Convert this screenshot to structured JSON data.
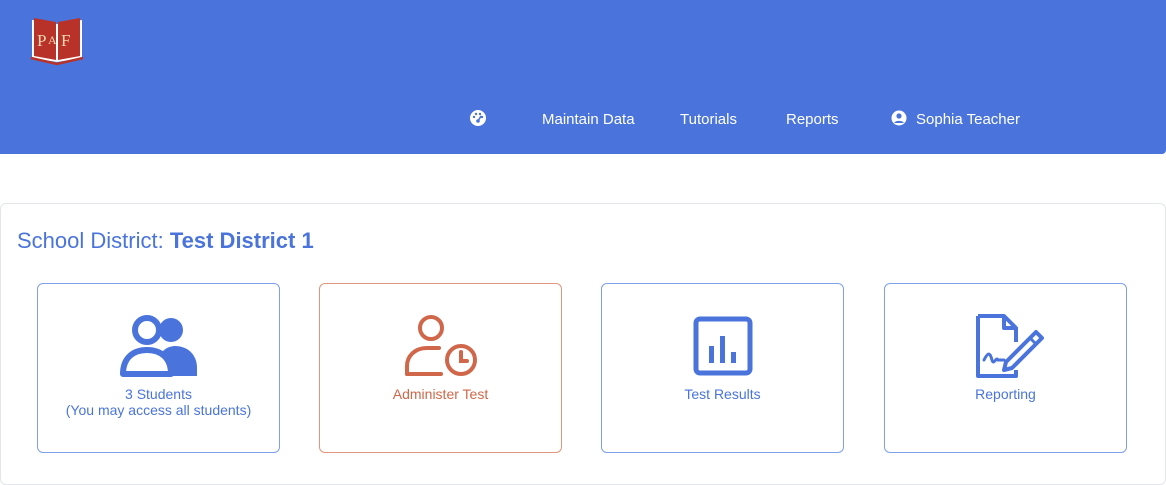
{
  "brand": {
    "logo_text": "PAF",
    "logo_colors": {
      "book": "#b8322a",
      "accent": "#ffffff"
    }
  },
  "colors": {
    "header_bg": "#4a74dc",
    "primary": "#4a74dc",
    "orange": "#d0674a"
  },
  "nav": {
    "dashboard_icon": "dashboard-gauge-icon",
    "maintain_data": "Maintain Data",
    "tutorials": "Tutorials",
    "reports": "Reports",
    "user_icon": "user-circle-icon",
    "user_name": "Sophia Teacher"
  },
  "district": {
    "prefix": "School District:",
    "name": "Test District 1"
  },
  "cards": [
    {
      "icon": "users-icon",
      "label": "3 Students",
      "sublabel": "(You may access all students)"
    },
    {
      "icon": "user-clock-icon",
      "label": "Administer Test"
    },
    {
      "icon": "bar-chart-icon",
      "label": "Test Results"
    },
    {
      "icon": "document-signature-icon",
      "label": "Reporting"
    }
  ]
}
